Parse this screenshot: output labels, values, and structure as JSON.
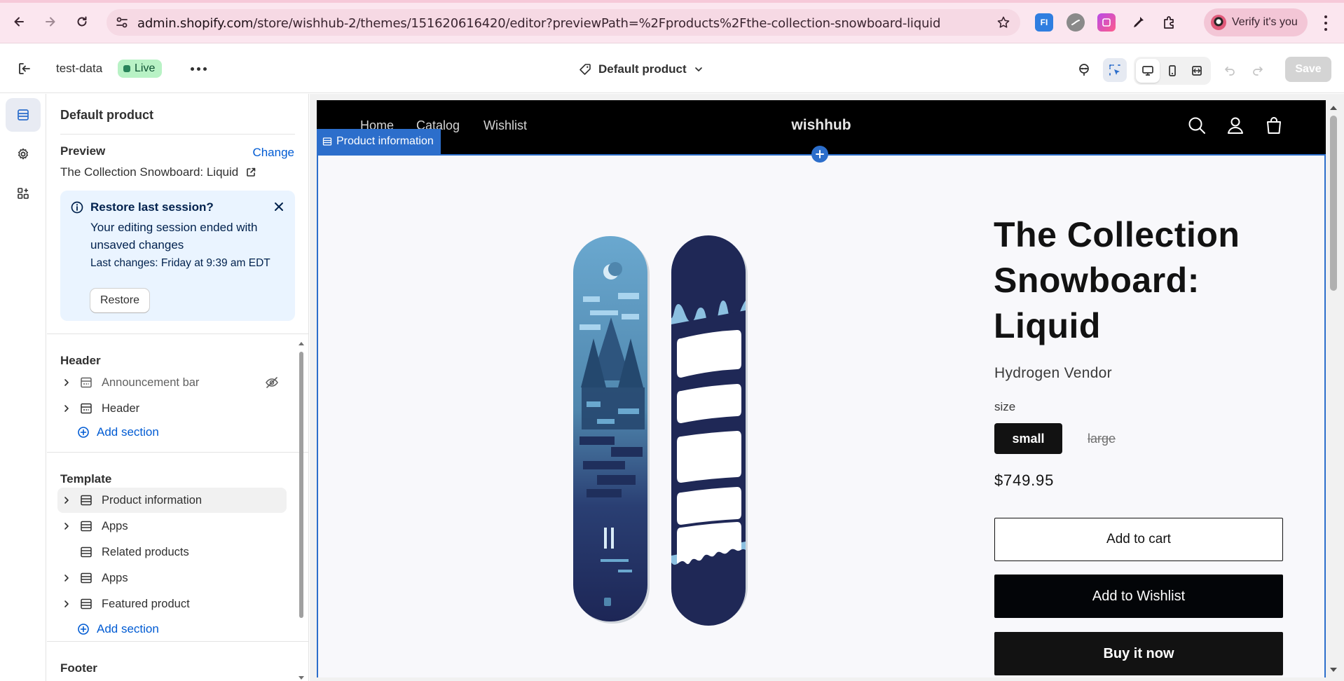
{
  "browser": {
    "url_host": "admin.shopify.com",
    "url_path": "/store/wishhub-2/themes/151620616420/editor?previewPath=%2Fproducts%2Fthe-collection-snowboard-liquid",
    "verify_label": "Verify it's you",
    "ext_fi_label": "FI",
    "icons": [
      "back-icon",
      "forward-icon",
      "reload-icon",
      "site-settings-icon",
      "bookmark-star-icon",
      "extensions-icon",
      "eyedropper-icon",
      "menu-icon"
    ]
  },
  "topbar": {
    "store_name": "test-data",
    "live_label": "Live",
    "template_name": "Default product",
    "save_label": "Save"
  },
  "sidebar": {
    "title": "Default product",
    "preview_label": "Preview",
    "change_label": "Change",
    "preview_product": "The Collection Snowboard: Liquid",
    "restore": {
      "title": "Restore last session?",
      "body": "Your editing session ended with unsaved changes",
      "meta": "Last changes: Friday at 9:39 am EDT",
      "button": "Restore"
    },
    "header_group": {
      "label": "Header",
      "items": [
        {
          "label": "Announcement bar",
          "hidden": true
        },
        {
          "label": "Header",
          "hidden": false
        }
      ],
      "add_label": "Add section"
    },
    "template_group": {
      "label": "Template",
      "items": [
        {
          "label": "Product information",
          "selected": true,
          "expandable": true
        },
        {
          "label": "Apps",
          "expandable": true
        },
        {
          "label": "Related products",
          "expandable": false
        },
        {
          "label": "Apps",
          "expandable": true
        },
        {
          "label": "Featured product",
          "expandable": true
        }
      ],
      "add_label": "Add section"
    },
    "footer_label": "Footer"
  },
  "store": {
    "nav": [
      "Home",
      "Catalog",
      "Wishlist"
    ],
    "logo": "wishhub",
    "selection_tag": "Product information",
    "product": {
      "title": "The Collection Snowboard: Liquid",
      "vendor": "Hydrogen Vendor",
      "size_label": "size",
      "sizes": [
        {
          "label": "small",
          "selected": true,
          "available": true
        },
        {
          "label": "large",
          "selected": false,
          "available": false
        }
      ],
      "price": "$749.95",
      "add_to_cart": "Add to cart",
      "add_to_wishlist": "Add to Wishlist",
      "buy_now": "Buy it now"
    }
  },
  "colors": {
    "accent_blue": "#2c6ecb",
    "link_blue": "#005bd3",
    "live_green": "#b8f2c5",
    "restore_bg": "#eaf4ff"
  }
}
